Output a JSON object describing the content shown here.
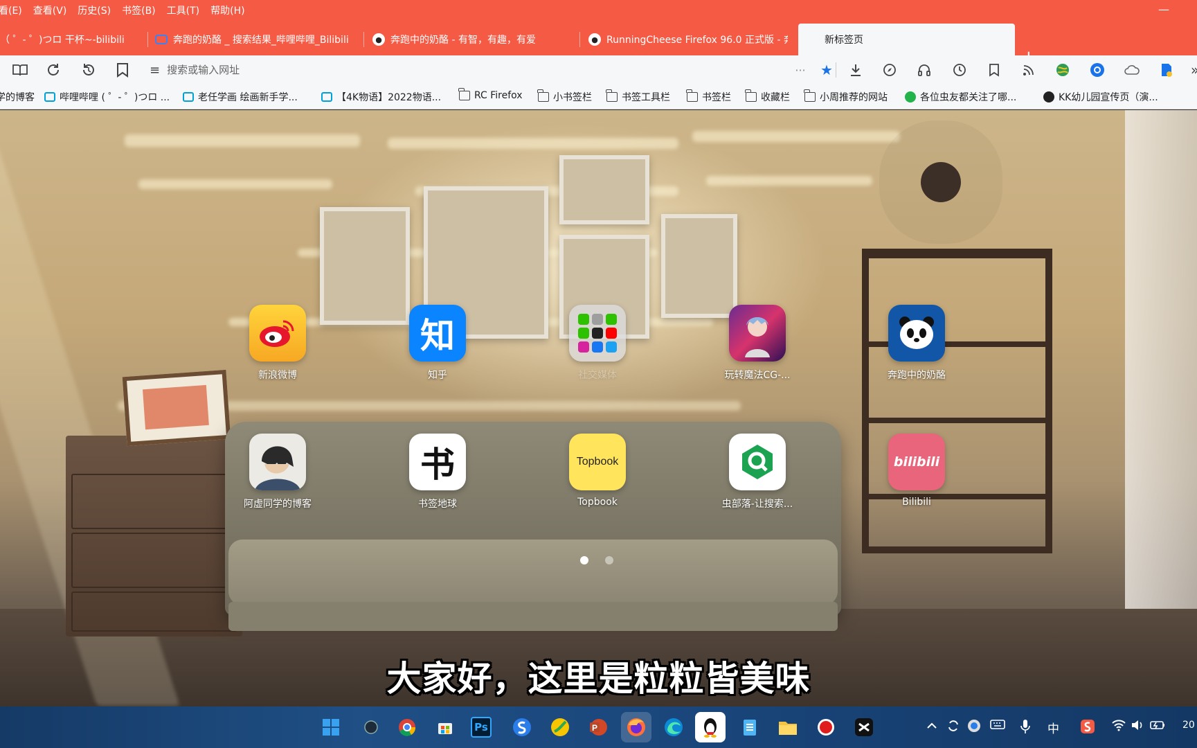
{
  "menu": {
    "items": [
      "看(E)",
      "查看(V)",
      "历史(S)",
      "书签(B)",
      "工具(T)",
      "帮助(H)"
    ],
    "minimize": "—"
  },
  "tabs": [
    {
      "title": "（ ゜- ゜)つロ 干杯~-bilibili",
      "icon": "bilibili-tv-icon"
    },
    {
      "title": "奔跑的奶酪 _ 搜索结果_哔哩哔哩_Bilibili",
      "icon": "bilibili-tv-icon"
    },
    {
      "title": "奔跑中的奶酪 - 有智，有趣，有爱",
      "icon": "panda-icon"
    },
    {
      "title": "RunningCheese Firefox 96.0 正式版 - 奔",
      "icon": "panda-icon"
    },
    {
      "title": "新标签页",
      "icon": "none"
    }
  ],
  "new_tab": "+",
  "nav": {
    "url_placeholder": "搜索或输入网址",
    "more": "···"
  },
  "bookmarks": [
    {
      "label": "学的博客",
      "icon": "none"
    },
    {
      "label": "哔哩哔哩 ( ゜- ゜)つロ ...",
      "icon": "bilibili-tv-icon"
    },
    {
      "label": "老任学画 绘画新手学...",
      "icon": "bilibili-tv-icon"
    },
    {
      "label": "【4K物语】2022物语...",
      "icon": "bilibili-tv-icon"
    },
    {
      "label": "RC Firefox",
      "icon": "folder-icon"
    },
    {
      "label": "小书签栏",
      "icon": "folder-icon"
    },
    {
      "label": "书签工具栏",
      "icon": "folder-icon"
    },
    {
      "label": "书签栏",
      "icon": "folder-icon"
    },
    {
      "label": "收藏栏",
      "icon": "folder-icon"
    },
    {
      "label": "小周推荐的网站",
      "icon": "folder-icon"
    },
    {
      "label": "各位虫友都关注了哪...",
      "icon": "chongbuluo-icon"
    },
    {
      "label": "KK幼儿园宣传页（演...",
      "icon": "kk-icon"
    }
  ],
  "speed_dial": {
    "row1": [
      {
        "label": "新浪微博",
        "icon": "weibo-icon"
      },
      {
        "label": "知乎",
        "icon": "zhihu-icon",
        "glyph": "知"
      },
      {
        "label": "社交媒体",
        "icon": "social-folder-icon"
      },
      {
        "label": "玩转魔法CG-...",
        "icon": "anime-avatar-icon"
      },
      {
        "label": "奔跑中的奶酪",
        "icon": "panda-icon"
      }
    ],
    "row2": [
      {
        "label": "阿虚同学的博客",
        "icon": "ahu-avatar-icon"
      },
      {
        "label": "书签地球",
        "icon": "shuqian-icon",
        "glyph": "书"
      },
      {
        "label": "Topbook",
        "icon": "topbook-icon",
        "glyph": "Topbook"
      },
      {
        "label": "虫部落-让搜索...",
        "icon": "chongbuluo-icon"
      },
      {
        "label": "Bilibili",
        "icon": "bilibili-icon",
        "glyph": "bilibili"
      }
    ],
    "page_count": 2,
    "current_page": 1
  },
  "subtitle": "大家好，这里是粒粒皆美味",
  "taskbar": {
    "ime": "中",
    "clock": "20"
  },
  "colors": {
    "tabbar": "#f55a44",
    "toolbar": "#f6f7f9",
    "accent_star": "#1a73e8"
  }
}
